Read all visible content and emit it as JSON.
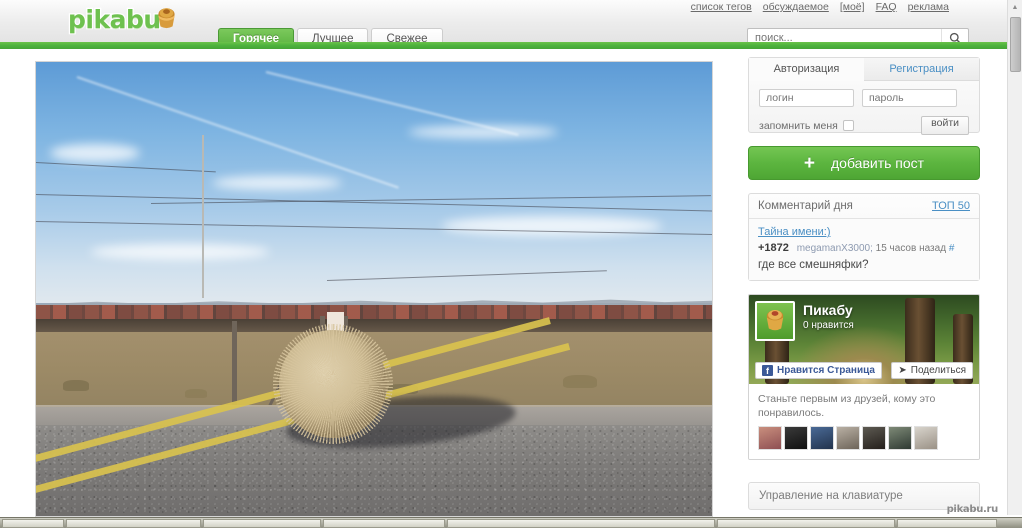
{
  "header": {
    "logo_text": "pikabu",
    "logo_icon": "muffin-icon",
    "tabs": [
      {
        "label": "Горячее",
        "active": true
      },
      {
        "label": "Лучшее",
        "active": false
      },
      {
        "label": "Свежее",
        "active": false
      }
    ],
    "top_links": [
      {
        "label": "список тегов"
      },
      {
        "label": "обсуждаемое"
      },
      {
        "label": "[моё]"
      },
      {
        "label": "FAQ"
      },
      {
        "label": "реклама"
      }
    ],
    "search": {
      "placeholder": "поиск...",
      "value": "",
      "icon": "search-icon"
    }
  },
  "auth": {
    "tab_login": "Авторизация",
    "tab_register": "Регистрация",
    "login_placeholder": "логин",
    "password_placeholder": "пароль",
    "remember_label": "запомнить меня",
    "submit_label": "войти"
  },
  "add_post": {
    "label": "добавить пост",
    "plus": "+"
  },
  "comment_of_day": {
    "heading": "Комментарий дня",
    "top_link": "ТОП 50",
    "post_title": "Тайна имени:)",
    "rating": "+1872",
    "user": "megamanX3000;",
    "time": "15 часов назад",
    "hash": "#",
    "text": "где все смешняфки?"
  },
  "facebook": {
    "page_name": "Пикабу",
    "likes": "0 нравится",
    "like_button": "Нравится Страница",
    "share_button": "Поделиться",
    "footer_text": "Станьте первым из друзей, кому это понравилось.",
    "faces_count": 7
  },
  "keyboard_panel": {
    "label": "Управление на клавиатуре"
  },
  "watermarks": {
    "page": "pikabu.ru",
    "photo": ""
  },
  "colors": {
    "brand_green": "#5cb53f",
    "strip_green": "#4db33d",
    "link_blue": "#4a8fc4",
    "facebook_blue": "#3b5998"
  },
  "photo": {
    "alt": "Перекати-поле на асфальтовой дороге в пустыне"
  }
}
